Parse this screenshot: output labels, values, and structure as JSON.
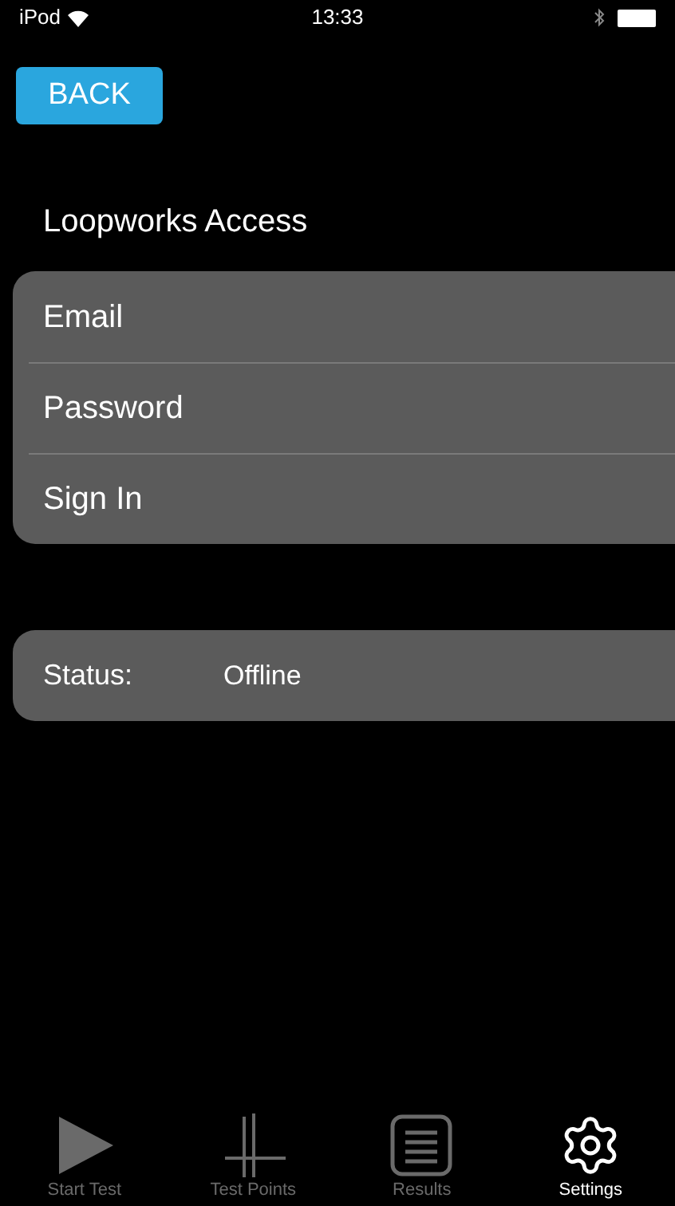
{
  "status_bar": {
    "carrier": "iPod",
    "time": "13:33"
  },
  "back_button": {
    "label": "BACK"
  },
  "section_title": "Loopworks Access",
  "login_rows": [
    {
      "label": "Email"
    },
    {
      "label": "Password"
    },
    {
      "label": "Sign In"
    }
  ],
  "status_row": {
    "label": "Status:",
    "value": "Offline"
  },
  "tab_bar": [
    {
      "label": "Start Test",
      "kind": "play",
      "selected": false
    },
    {
      "label": "Test Points",
      "kind": "crosshair",
      "selected": false
    },
    {
      "label": "Results",
      "kind": "list",
      "selected": false
    },
    {
      "label": "Settings",
      "kind": "gear",
      "selected": true
    }
  ]
}
